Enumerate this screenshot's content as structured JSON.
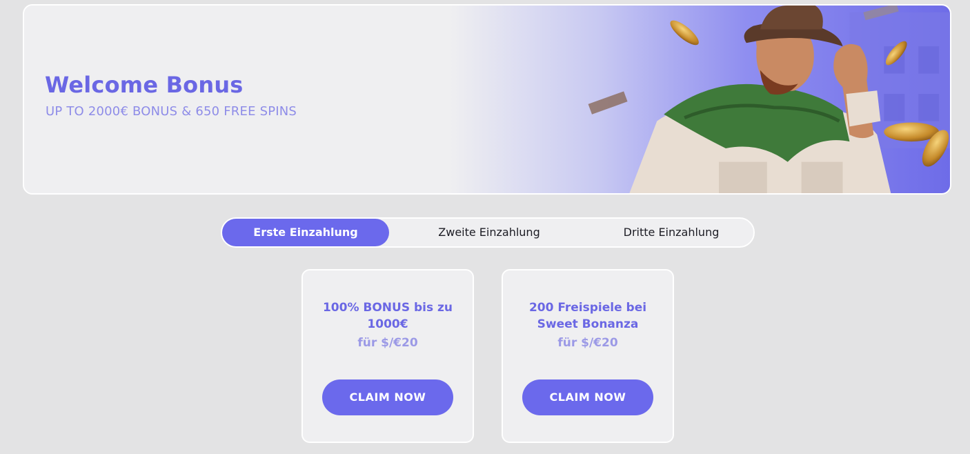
{
  "banner": {
    "title": "Welcome Bonus",
    "subtitle": "UP TO 2000€ BONUS & 650 FREE SPINS",
    "image": "cowboy-slot-character-illustration"
  },
  "tabs": [
    {
      "label": "Erste Einzahlung",
      "active": true
    },
    {
      "label": "Zweite Einzahlung",
      "active": false
    },
    {
      "label": "Dritte Einzahlung",
      "active": false
    }
  ],
  "offers": [
    {
      "title": "100% BONUS bis zu 1000€",
      "subtitle": "für $/€20",
      "button": "CLAIM NOW"
    },
    {
      "title": "200 Freispiele bei Sweet Bonanza",
      "subtitle": "für $/€20",
      "button": "CLAIM NOW"
    }
  ],
  "colors": {
    "accent": "#6b69ec",
    "background": "#e3e3e4",
    "card": "#efeff1"
  }
}
